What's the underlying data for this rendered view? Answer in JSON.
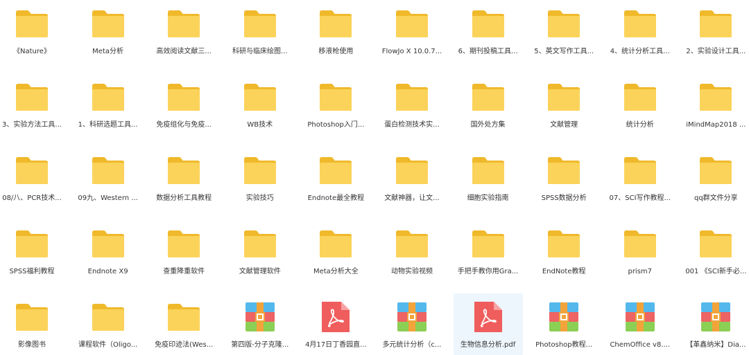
{
  "colors": {
    "folder_back": "#f0b92b",
    "folder_front": "#fbd35a",
    "pdf_red": "#f05d5d",
    "archive_blue": "#54b8ec",
    "archive_red": "#ee6363",
    "archive_green": "#8ccf55",
    "archive_belt": "#f2a43a",
    "label_text": "#333333",
    "selection_bg": "#edf6fd"
  },
  "items": [
    {
      "name": "《Nature》",
      "type": "folder"
    },
    {
      "name": "Meta分析",
      "type": "folder"
    },
    {
      "name": "高效阅读文献三...",
      "type": "folder"
    },
    {
      "name": "科研与临床绘图...",
      "type": "folder"
    },
    {
      "name": "移液枪使用",
      "type": "folder"
    },
    {
      "name": "FlowJo X 10.0.7...",
      "type": "folder"
    },
    {
      "name": "6、期刊投稿工具...",
      "type": "folder"
    },
    {
      "name": "5、英文写作工具...",
      "type": "folder"
    },
    {
      "name": "4、统计分析工具...",
      "type": "folder"
    },
    {
      "name": "2、实验设计工具...",
      "type": "folder"
    },
    {
      "name": "3、实验方法工具...",
      "type": "folder"
    },
    {
      "name": "1、科研选题工具...",
      "type": "folder"
    },
    {
      "name": "免疫组化与免疫...",
      "type": "folder"
    },
    {
      "name": "WB技术",
      "type": "folder"
    },
    {
      "name": "Photoshop入门...",
      "type": "folder"
    },
    {
      "name": "蛋白检测技术实...",
      "type": "folder"
    },
    {
      "name": "国外处方集",
      "type": "folder"
    },
    {
      "name": "文献管理",
      "type": "folder"
    },
    {
      "name": "统计分析",
      "type": "folder"
    },
    {
      "name": "iMindMap2018 ...",
      "type": "folder"
    },
    {
      "name": "08/八、PCR技术...",
      "type": "folder"
    },
    {
      "name": "09九、Western ...",
      "type": "folder"
    },
    {
      "name": "数据分析工具教程",
      "type": "folder"
    },
    {
      "name": "实验技巧",
      "type": "folder"
    },
    {
      "name": "Endnote最全教程",
      "type": "folder"
    },
    {
      "name": "文献神器，让文...",
      "type": "folder"
    },
    {
      "name": "细胞实验指南",
      "type": "folder"
    },
    {
      "name": "SPSS数据分析",
      "type": "folder"
    },
    {
      "name": "07、SCI写作教程...",
      "type": "folder"
    },
    {
      "name": "qq群文件分享",
      "type": "folder"
    },
    {
      "name": "SPSS福利教程",
      "type": "folder"
    },
    {
      "name": "Endnote X9",
      "type": "folder"
    },
    {
      "name": "查重降重软件",
      "type": "folder"
    },
    {
      "name": "文献管理软件",
      "type": "folder"
    },
    {
      "name": "Meta分析大全",
      "type": "folder"
    },
    {
      "name": "动物实验视频",
      "type": "folder"
    },
    {
      "name": "手把手教你用Gra...",
      "type": "folder"
    },
    {
      "name": "EndNote教程",
      "type": "folder"
    },
    {
      "name": "prism7",
      "type": "folder"
    },
    {
      "name": "001 《SCI新手必...",
      "type": "folder"
    },
    {
      "name": "影像图书",
      "type": "folder"
    },
    {
      "name": "课程软件（Oligo...",
      "type": "folder"
    },
    {
      "name": "免疫印迹法(Wes...",
      "type": "folder"
    },
    {
      "name": "第四版-分子克隆...",
      "type": "archive"
    },
    {
      "name": "4月17日丁香园直...",
      "type": "pdf"
    },
    {
      "name": "多元统计分析（c...",
      "type": "archive"
    },
    {
      "name": "生物信息分析.pdf",
      "type": "pdf",
      "selected": true
    },
    {
      "name": "Photoshop教程...",
      "type": "archive"
    },
    {
      "name": "ChemOffice v8....",
      "type": "archive"
    },
    {
      "name": "【革鑫纳米】Dia...",
      "type": "archive"
    }
  ]
}
